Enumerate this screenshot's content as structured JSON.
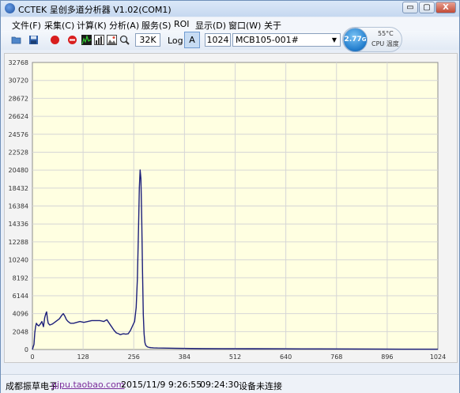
{
  "window": {
    "title": "CCTEK 呈创多道分析器 V1.02(COM1)",
    "min_glyph": "▭",
    "max_glyph": "▢",
    "close_glyph": "X"
  },
  "menu": [
    "文件(F)",
    "采集(C)",
    "计算(K)",
    "分析(A)",
    "服务(S)",
    "ROI",
    "显示(D)",
    "窗口(W)",
    "关于"
  ],
  "toolbar": {
    "range_value": "32K",
    "log_label": "Log",
    "auto_label": "A",
    "channels_value": "1024",
    "device_select": "MCB105-001#",
    "icons": [
      "open-folder-icon",
      "save-disk-icon",
      "record-icon",
      "stop-icon",
      "spectrum-icon",
      "bar-chart-icon",
      "image-icon",
      "zoom-icon"
    ],
    "accent": "#2a7fd0"
  },
  "cpu_monitor": {
    "usage": "2.77",
    "usage_unit": "G",
    "temperature": "55°C",
    "label": "CPU 温度"
  },
  "chart_data": {
    "type": "line",
    "x_ticks": [
      "0",
      "128",
      "256",
      "384",
      "512",
      "640",
      "768",
      "896",
      "1024"
    ],
    "y_ticks": [
      "0",
      "2048",
      "4096",
      "6144",
      "8192",
      "10240",
      "12288",
      "14336",
      "16384",
      "18432",
      "20480",
      "22528",
      "24576",
      "26624",
      "28672",
      "30720",
      "32768"
    ],
    "xlim": [
      0,
      1024
    ],
    "ylim": [
      0,
      32768
    ],
    "grid": true,
    "line_color": "#1c1f7a",
    "background": "#ffffe1",
    "x": [
      0,
      4,
      6,
      8,
      10,
      13,
      16,
      20,
      24,
      28,
      31,
      34,
      36,
      38,
      40,
      44,
      50,
      56,
      62,
      68,
      74,
      78,
      82,
      86,
      90,
      96,
      104,
      112,
      120,
      130,
      140,
      150,
      160,
      170,
      180,
      188,
      194,
      200,
      206,
      212,
      218,
      222,
      226,
      230,
      236,
      242,
      248,
      254,
      258,
      262,
      265,
      268,
      270,
      272,
      274,
      276,
      278,
      280,
      282,
      284,
      286,
      288,
      290,
      292,
      296,
      300,
      306,
      316,
      330,
      360,
      400,
      480,
      560,
      640,
      720,
      800,
      880,
      960,
      1024
    ],
    "y": [
      0,
      600,
      1900,
      2600,
      3000,
      2800,
      2700,
      2900,
      3200,
      2600,
      3600,
      4100,
      4300,
      3500,
      3000,
      2800,
      2900,
      3100,
      3300,
      3500,
      3900,
      4100,
      3800,
      3400,
      3200,
      3000,
      3000,
      3100,
      3200,
      3100,
      3200,
      3300,
      3300,
      3300,
      3200,
      3400,
      3000,
      2600,
      2200,
      1900,
      1800,
      1700,
      1750,
      1800,
      1750,
      1800,
      2200,
      2800,
      3200,
      4800,
      8000,
      14000,
      18500,
      20500,
      19500,
      15000,
      9000,
      4000,
      1800,
      800,
      500,
      400,
      320,
      270,
      230,
      210,
      190,
      170,
      160,
      140,
      120,
      100,
      90,
      80,
      70,
      60,
      50,
      40,
      40
    ]
  },
  "status": {
    "company": "成都振草电子",
    "link": "qjpu.taobao.com",
    "date": "2015/11/9 9:26:55",
    "elapsed": "09:24:30",
    "connection": "设备未连接"
  }
}
